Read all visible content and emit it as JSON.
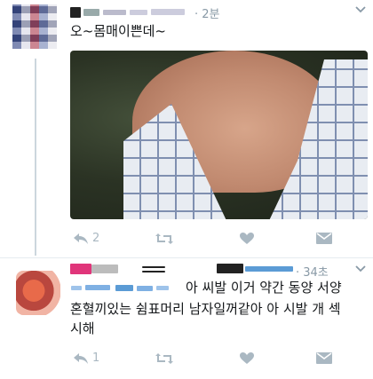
{
  "tweet1": {
    "timestamp": "· 2분",
    "text": "오~몸매이쁜데~",
    "actions": {
      "reply_count": "2",
      "retweet_count": "",
      "like_count": ""
    }
  },
  "tweet2": {
    "timestamp": "· 34초",
    "line1": "아 씨발 이거 약간 동양 서양",
    "line2": "혼혈끼있는 쉼표머리 남자일꺼같아 아 시발 개 섹",
    "line3": "시해",
    "actions": {
      "reply_count": "1",
      "retweet_count": "",
      "like_count": ""
    }
  },
  "icons": {
    "reply": "reply-icon",
    "retweet": "retweet-icon",
    "like": "heart-icon",
    "message": "envelope-icon",
    "more": "chevron-down-icon"
  },
  "colors": {
    "icon_gray": "#aab8c2",
    "meta_gray": "#8899a6",
    "thread_line": "#ccd6dd",
    "text": "#14171a",
    "censor_pink": "#e0357a",
    "censor_blue": "#5b9bd5"
  }
}
